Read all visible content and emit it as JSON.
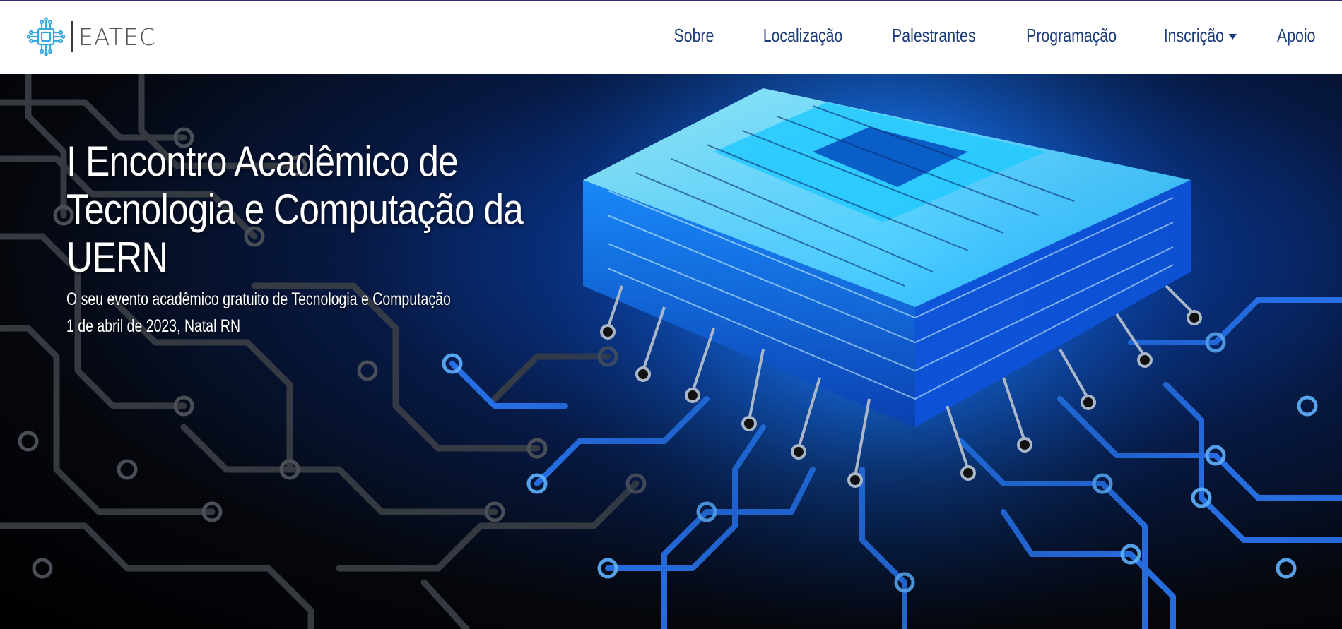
{
  "brand": {
    "name": "EATEC",
    "logo_icon": "circuit-chip-icon"
  },
  "nav": {
    "items": [
      {
        "label": "Sobre"
      },
      {
        "label": "Localização"
      },
      {
        "label": "Palestrantes"
      },
      {
        "label": "Programação"
      },
      {
        "label": "Inscrição",
        "dropdown": true
      },
      {
        "label": "Apoio"
      }
    ]
  },
  "hero": {
    "title": "I Encontro Acadêmico de Tecnologia e Computação da UERN",
    "subtitle": "O seu evento acadêmico gratuito de Tecnologia e Computação",
    "date": "1 de abril de 2023, Natal RN",
    "background": "glowing-circuit-board-processor-image"
  },
  "colors": {
    "nav_text": "#1d3d7a",
    "accent": "#3aa8e0",
    "hero_glow": "#0d5bd6"
  }
}
